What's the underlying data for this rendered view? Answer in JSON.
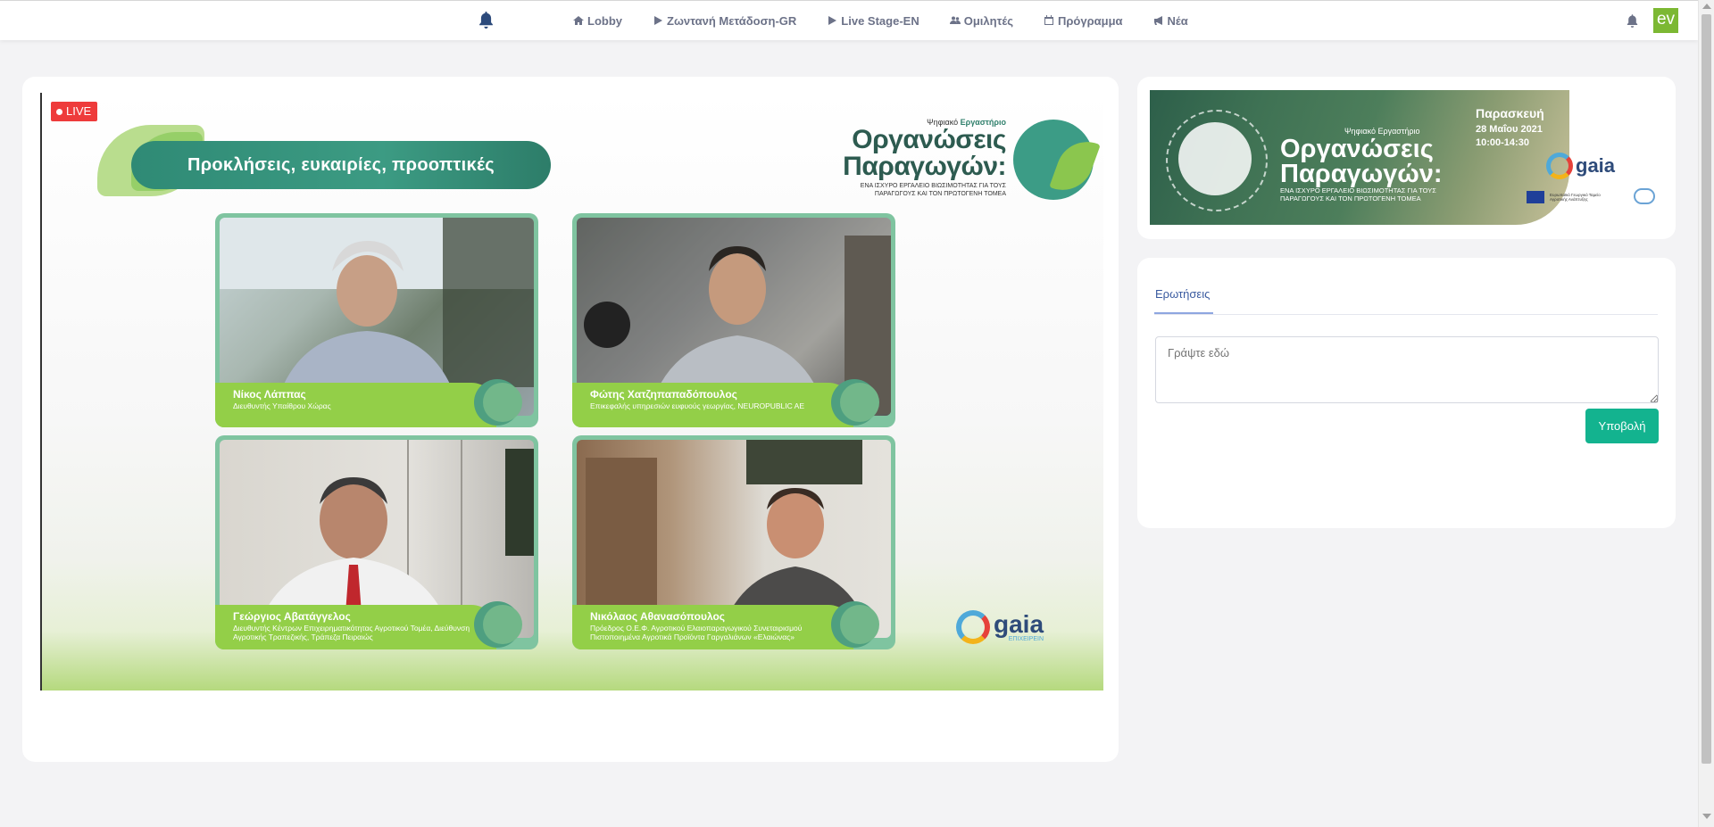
{
  "nav": {
    "items": [
      {
        "label": "Lobby",
        "icon": "home-icon"
      },
      {
        "label": "Ζωντανή Μετάδοση-GR",
        "icon": "play-icon"
      },
      {
        "label": "Live Stage-EN",
        "icon": "play-icon"
      },
      {
        "label": "Ομιλητές",
        "icon": "users-icon"
      },
      {
        "label": "Πρόγραμμα",
        "icon": "calendar-icon"
      },
      {
        "label": "Νέα",
        "icon": "bullhorn-icon"
      }
    ],
    "logo_text": "ev",
    "icon_color": "#6c7288",
    "accent": "#7cb833"
  },
  "stream": {
    "live_label": "LIVE",
    "title": "Προκλήσεις, ευκαιρίες, προοπτικές",
    "logo_small_prefix": "Ψηφιακό",
    "logo_small_strong": "Εργαστήριο",
    "logo_line1": "Οργανώσεις",
    "logo_line2": "Παραγωγών:",
    "logo_tagline": "ΕΝΑ ΙΣΧΥΡΟ ΕΡΓΑΛΕΙΟ ΒΙΩΣΙΜΟΤΗΤΑΣ ΓΙΑ ΤΟΥΣ ΠΑΡΑΓΩΓΟΥΣ ΚΑΙ ΤΟΝ ΠΡΩΤΟΓΕΝΗ ΤΟΜΕΑ",
    "sponsor": "gaia",
    "sponsor_sub": "ΕΠΙΧΕΙΡΕΙΝ",
    "speakers": [
      {
        "name": "Νίκος Λάππας",
        "role": "Διευθυντής Υπαίθρου Χώρας"
      },
      {
        "name": "Φώτης Χατζηπαπαδόπουλος",
        "role": "Επικεφαλής υπηρεσιών ευφυούς γεωργίας, NEUROPUBLIC AE"
      },
      {
        "name": "Γεώργιος Αβατάγγελος",
        "role": "Διευθυντής Κέντρων Επιχειρηματικότητας Αγροτικού Τομέα, Διεύθυνση Αγροτικής Τραπεζικής, Τράπεζα Πειραιώς"
      },
      {
        "name": "Νικόλαος Αθανασόπουλος",
        "role": "Πρόεδρος Ο.Ε.Φ. Αγροτικού Ελαιοπαραγωγικού Συνεταιρισμού Πιστοποιημένα Αγροτικά Προϊόντα Γαργαλιάνων «Ελαιώνας»"
      }
    ]
  },
  "banner": {
    "small": "Ψηφιακό Εργαστήριο",
    "line1": "Οργανώσεις",
    "line2": "Παραγωγών:",
    "tagline": "ΕΝΑ ΙΣΧΥΡΟ ΕΡΓΑΛΕΙΟ ΒΙΩΣΙΜΟΤΗΤΑΣ ΓΙΑ ΤΟΥΣ ΠΑΡΑΓΩΓΟΥΣ ΚΑΙ ΤΟΝ ΠΡΩΤΟΓΕΝΗ ΤΟΜΕΑ",
    "day": "Παρασκευή",
    "date": "28 Μαΐου 2021",
    "time": "10:00-14:30",
    "sponsor": "gaia",
    "eu_note": "Ευρωπαϊκό Γεωργικό Ταμείο Αγροτικής Ανάπτυξης"
  },
  "qa": {
    "tab_label": "Ερωτήσεις",
    "input_placeholder": "Γράψτε εδώ",
    "submit_label": "Υποβολή",
    "submit_color": "#13b38f"
  }
}
